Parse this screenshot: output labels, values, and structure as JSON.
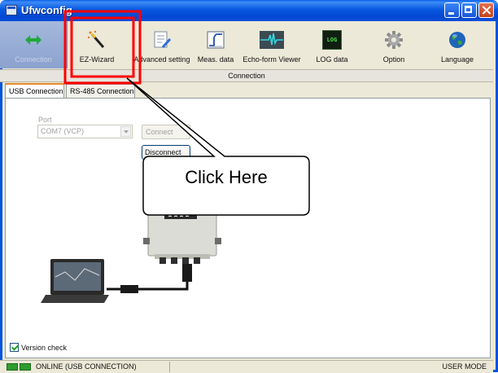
{
  "window": {
    "title": "Ufwconfig"
  },
  "toolbar": {
    "items": [
      {
        "label": "Connection",
        "icon": "double-arrow-icon"
      },
      {
        "label": "EZ-Wizard",
        "icon": "wand-icon"
      },
      {
        "label": "Advanced setting",
        "icon": "notepad-pencil-icon"
      },
      {
        "label": "Meas. data",
        "icon": "step-graph-icon"
      },
      {
        "label": "Echo-form Viewer",
        "icon": "waveform-icon"
      },
      {
        "label": "LOG data",
        "icon": "log-icon",
        "icon_text": "LOG"
      },
      {
        "label": "Option",
        "icon": "gear-icon"
      },
      {
        "label": "Language",
        "icon": "globe-icon"
      }
    ]
  },
  "section": {
    "title": "Connection"
  },
  "tabs": [
    {
      "label": "USB Connection",
      "active": true
    },
    {
      "label": "RS-485 Connection",
      "active": false
    }
  ],
  "form": {
    "port_label": "Port",
    "port_value": "COM7 (VCP)",
    "connect_label": "Connect",
    "disconnect_label": "Disconnect"
  },
  "callout": {
    "text": "Click Here"
  },
  "version_check": {
    "label": "Version check",
    "checked": true
  },
  "status": {
    "connection": "ONLINE (USB CONNECTION)",
    "mode": "USER MODE"
  },
  "colors": {
    "highlight": "#ff0000",
    "accent": "#0054e3",
    "led": "#2f9d2f"
  }
}
